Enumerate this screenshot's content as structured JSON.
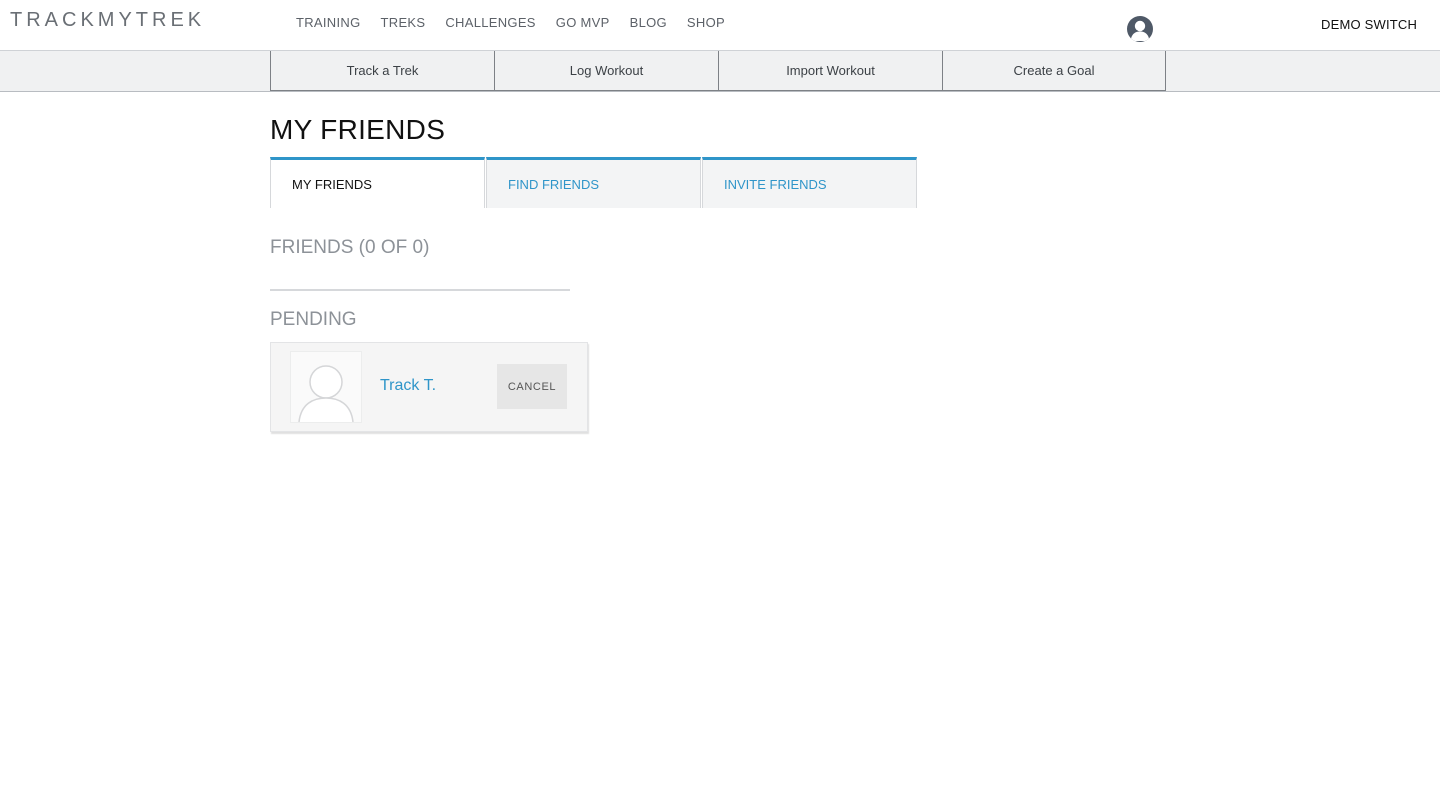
{
  "header": {
    "logo": "TRACKMYTREK",
    "nav": [
      "TRAINING",
      "TREKS",
      "CHALLENGES",
      "GO MVP",
      "BLOG",
      "SHOP"
    ],
    "account_name": "DEMO SWITCH"
  },
  "actions": [
    "Track a Trek",
    "Log Workout",
    "Import Workout",
    "Create a Goal"
  ],
  "page": {
    "title": "MY FRIENDS",
    "tabs": [
      {
        "label": "MY FRIENDS",
        "active": true
      },
      {
        "label": "FIND FRIENDS",
        "active": false
      },
      {
        "label": "INVITE FRIENDS",
        "active": false
      }
    ],
    "friends_heading": "FRIENDS (0 OF 0)",
    "pending_heading": "PENDING",
    "pending": [
      {
        "name": "Track T.",
        "action_label": "CANCEL"
      }
    ]
  },
  "colors": {
    "accent": "#2f95c9",
    "avatar_dark": "#4f5967",
    "muted_heading": "#8d9298"
  },
  "icons": {
    "profile": "user-avatar-icon",
    "placeholder": "user-silhouette-icon"
  }
}
